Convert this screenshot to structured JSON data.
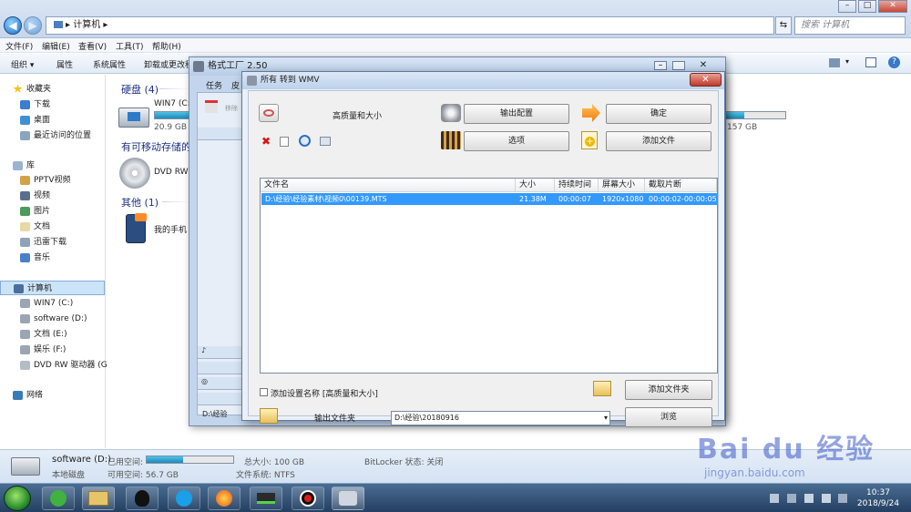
{
  "explorer": {
    "breadcrumb": "▸ 计算机 ▸",
    "search_placeholder": "搜索 计算机",
    "menu": [
      "文件(F)",
      "编辑(E)",
      "查看(V)",
      "工具(T)",
      "帮助(H)"
    ],
    "toolbar": [
      "组织 ▾",
      "属性",
      "系统属性",
      "卸载或更改程"
    ],
    "sidebar": {
      "favorites_title": "收藏夹",
      "favorites": [
        "下载",
        "桌面",
        "最近访问的位置"
      ],
      "library_title": "库",
      "libraries": [
        "PPTV视频",
        "视频",
        "图片",
        "文档",
        "迅雷下载",
        "音乐"
      ],
      "computer_title": "计算机",
      "drives": [
        "WIN7 (C:)",
        "software (D:)",
        "文档 (E:)",
        "娱乐 (F:)",
        "DVD RW 驱动器 (G"
      ],
      "network": "网络"
    },
    "content": {
      "group_hdd": "硬盘 (4)",
      "drive_c_name": "WIN7 (C:",
      "drive_c_size": "20.9 GB",
      "drive_f_size": "157 GB",
      "group_removable": "有可移动存储的",
      "dvd_label": "DVD RW",
      "group_other": "其他 (1)",
      "phone_label": "我的手机"
    },
    "status": {
      "drive_name": "software (D:)",
      "used_label": "已用空间:",
      "used_fraction": 0.42,
      "total_label": "总大小: 100 GB",
      "bitlocker": "BitLocker 状态: 关闭",
      "type": "本地磁盘",
      "free_label": "可用空间: 56.7 GB",
      "filesystem": "文件系统: NTFS"
    }
  },
  "formatfactory": {
    "title": "格式工厂 2.50",
    "tabs": [
      "任务",
      "皮"
    ],
    "list_item": "移除",
    "path_hint": "D:\\经验"
  },
  "dialog": {
    "title": "所有 转到 WMV",
    "quality": "高质量和大小",
    "btn_output_config": "输出配置",
    "btn_ok": "确定",
    "btn_options": "选项",
    "btn_add_file": "添加文件",
    "columns": [
      "文件名",
      "大小",
      "持续时间",
      "屏幕大小",
      "截取片断"
    ],
    "rows": [
      [
        "D:\\经验\\经验素材\\视频0\\00139.MTS",
        "21.38M",
        "00:00:07",
        "1920x1080",
        "00:00:02-00:00:05"
      ]
    ],
    "add_setting_name": "添加设置名称 [高质量和大小]",
    "btn_add_folder": "添加文件夹",
    "output_folder_label": "输出文件夹",
    "output_folder_value": "D:\\经验\\20180916",
    "btn_browse": "浏览"
  },
  "taskbar": {
    "time": "10:37",
    "date": "2018/9/24"
  },
  "watermark": {
    "brand": "Bai du 经验",
    "url": "jingyan.baidu.com"
  }
}
